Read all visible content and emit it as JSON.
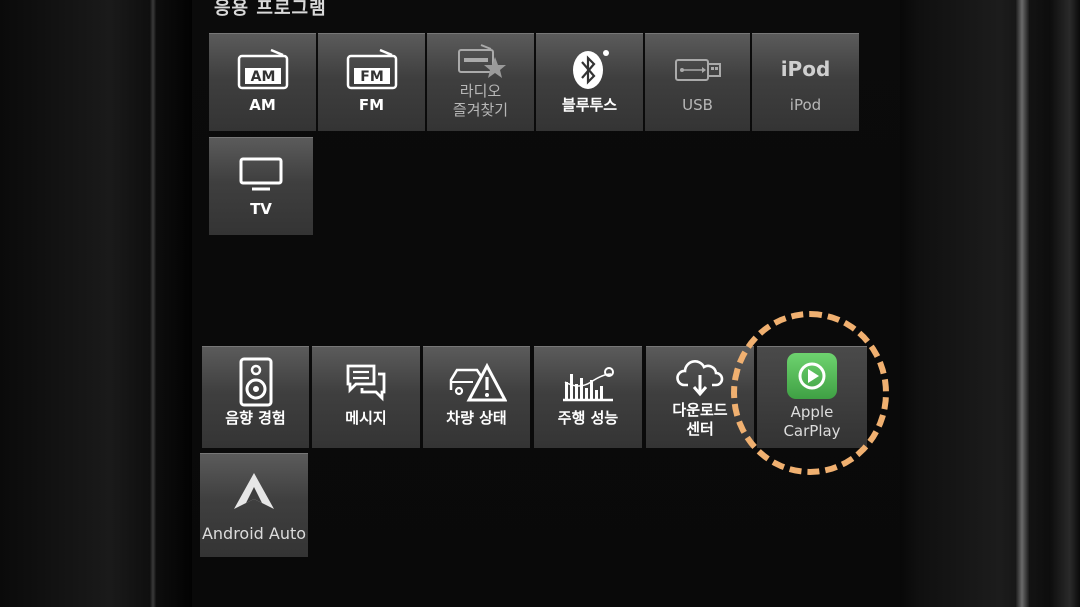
{
  "screen": {
    "section_title": "응용 프로그램"
  },
  "apps": [
    {
      "label": "AM",
      "icon": "am-radio-icon",
      "badge": "AM"
    },
    {
      "label": "FM",
      "icon": "fm-radio-icon",
      "badge": "FM"
    },
    {
      "label": "라디오\n즐겨찾기",
      "icon": "radio-favorites-icon"
    },
    {
      "label": "블루투스",
      "icon": "bluetooth-icon"
    },
    {
      "label": "USB",
      "icon": "usb-icon"
    },
    {
      "label": "iPod",
      "icon": "ipod-icon",
      "icon_text": "iPod"
    },
    {
      "label": "TV",
      "icon": "tv-icon"
    },
    {
      "label": "음향 경험",
      "icon": "speaker-icon"
    },
    {
      "label": "메시지",
      "icon": "message-icon"
    },
    {
      "label": "차량 상태",
      "icon": "car-warning-icon"
    },
    {
      "label": "주행 성능",
      "icon": "performance-chart-icon"
    },
    {
      "label": "다운로드\n센터",
      "icon": "cloud-download-icon"
    },
    {
      "label": "Apple\nCarPlay",
      "icon": "carplay-icon"
    },
    {
      "label": "Android Auto",
      "icon": "android-auto-icon"
    }
  ],
  "colors": {
    "highlight": "#f0b070",
    "carplay_green": "#5cc25e",
    "tile": "#464646"
  }
}
